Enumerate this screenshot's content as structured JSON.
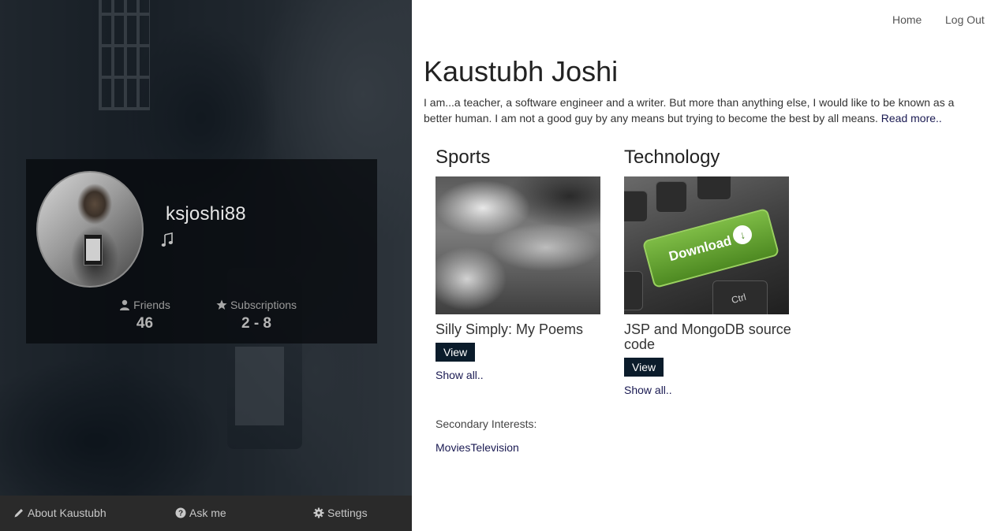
{
  "profile": {
    "username": "ksjoshi88",
    "music_icon": "music-note-icon",
    "stats": [
      {
        "label": "Friends",
        "value": "46",
        "icon": "user-icon"
      },
      {
        "label": "Subscriptions",
        "value": "2 - 8",
        "icon": "star-icon"
      }
    ]
  },
  "bottom_bar": {
    "items": [
      {
        "label": "About Kaustubh",
        "icon": "pencil-icon"
      },
      {
        "label": "Ask me",
        "icon": "question-circle-icon"
      },
      {
        "label": "Settings",
        "icon": "gear-icon"
      }
    ]
  },
  "nav": {
    "home": "Home",
    "logout": "Log Out"
  },
  "main": {
    "name": "Kaustubh Joshi",
    "bio": "I am...a teacher, a software engineer and a writer. But more than anything else, I would like to be known as a better human. I am not a good guy by any means but trying to become the best by all means.",
    "read_more": "Read more..",
    "interests": [
      {
        "title": "Sports",
        "post_title": "Silly Simply: My Poems",
        "view_label": "View",
        "show_all": "Show all.."
      },
      {
        "title": "Technology",
        "post_title": "JSP and MongoDB source code",
        "view_label": "View",
        "show_all": "Show all..",
        "image_text": "Download",
        "image_key_text": "Ctrl"
      }
    ],
    "secondary_label": "Secondary Interests:",
    "secondary_interests": [
      "Movies",
      "Television"
    ]
  },
  "colors": {
    "button_bg": "#0b1c2b",
    "link": "#1a1a52",
    "bottom_bar_bg": "#2a2a2a"
  }
}
